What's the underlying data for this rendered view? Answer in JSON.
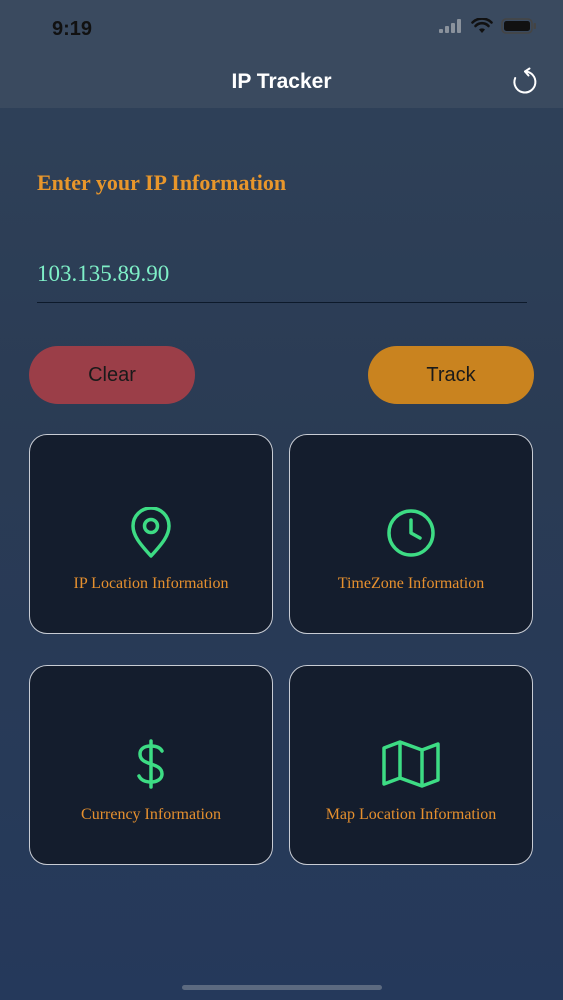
{
  "status_bar": {
    "time": "9:19"
  },
  "nav": {
    "title": "IP Tracker",
    "refresh_icon": "refresh-icon"
  },
  "form": {
    "prompt": "Enter your IP Information",
    "ip_value": "103.135.89.90",
    "clear_label": "Clear",
    "track_label": "Track"
  },
  "cards": [
    {
      "label": "IP Location Information",
      "icon": "location-pin-icon"
    },
    {
      "label": "TimeZone Information",
      "icon": "clock-icon"
    },
    {
      "label": "Currency Information",
      "icon": "dollar-icon"
    },
    {
      "label": "Map Location Information",
      "icon": "map-icon"
    }
  ],
  "colors": {
    "accent_orange": "#e8962b",
    "icon_green": "#3ddc84",
    "input_text": "#7ff0c8",
    "clear_button": "#9b3e48",
    "track_button": "#c9831f"
  }
}
